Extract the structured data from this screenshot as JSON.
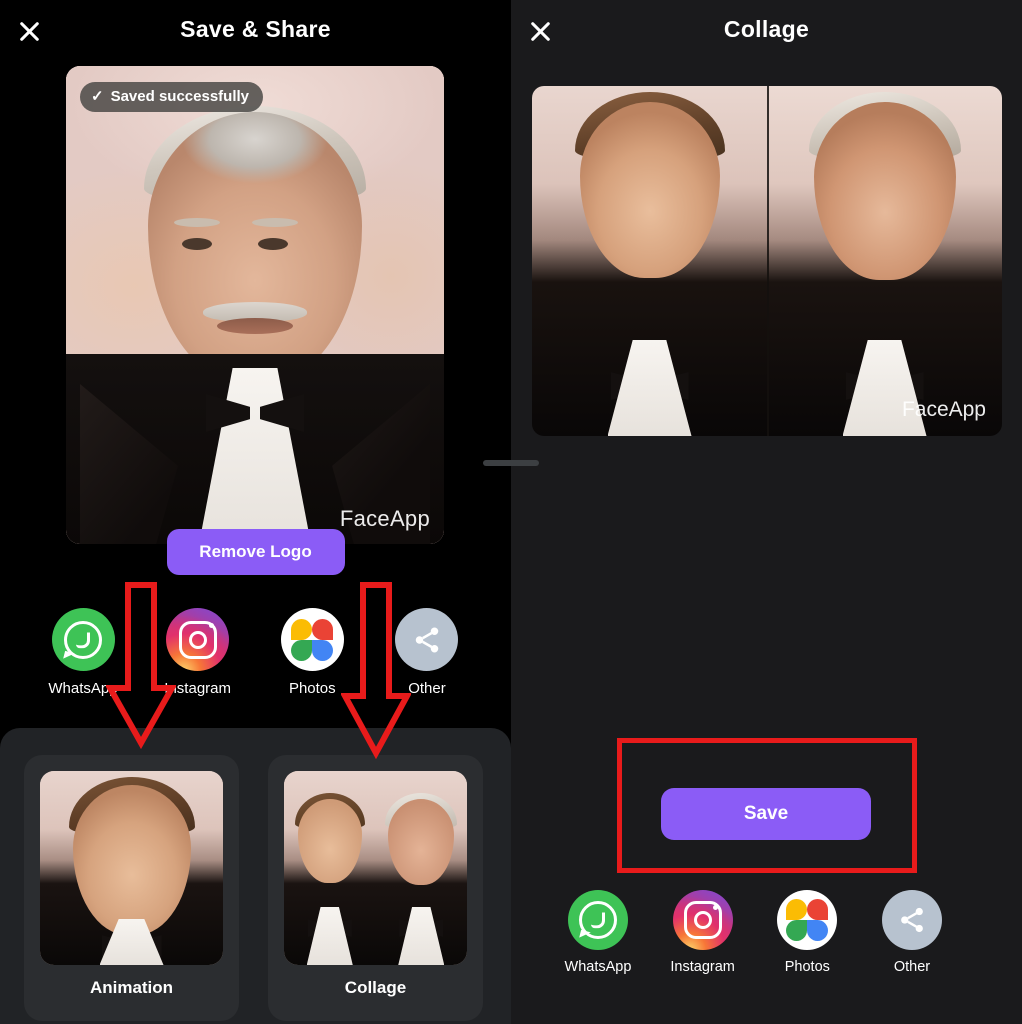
{
  "app": {
    "watermark": "FaceApp",
    "accent_color": "#8b5cf6",
    "annotation_color": "#e81b1b"
  },
  "left_panel": {
    "header": {
      "title": "Save & Share",
      "close_icon": "close-icon"
    },
    "toast": {
      "text": "Saved successfully",
      "icon": "check-icon"
    },
    "photo": {
      "watermark": "FaceApp",
      "alt": "aged portrait result"
    },
    "remove_logo_label": "Remove Logo",
    "share": [
      {
        "label": "WhatsApp",
        "icon": "whatsapp-icon"
      },
      {
        "label": "Instagram",
        "icon": "instagram-icon"
      },
      {
        "label": "Photos",
        "icon": "google-photos-icon"
      },
      {
        "label": "Other",
        "icon": "share-icon"
      }
    ],
    "options": [
      {
        "label": "Animation",
        "thumb": "single portrait"
      },
      {
        "label": "Collage",
        "thumb": "side by side portraits"
      }
    ]
  },
  "right_panel": {
    "header": {
      "title": "Collage",
      "close_icon": "close-icon"
    },
    "collage": {
      "watermark": "FaceApp",
      "left_alt": "original portrait",
      "right_alt": "aged portrait"
    },
    "handle": "drag-handle",
    "save_label": "Save",
    "share": [
      {
        "label": "WhatsApp",
        "icon": "whatsapp-icon"
      },
      {
        "label": "Instagram",
        "icon": "instagram-icon"
      },
      {
        "label": "Photos",
        "icon": "google-photos-icon"
      },
      {
        "label": "Other",
        "icon": "share-icon"
      }
    ]
  },
  "annotations": {
    "arrow_1": "arrow pointing to Animation card",
    "arrow_2": "arrow pointing to Collage card",
    "rect_1": "highlight around Save button"
  }
}
